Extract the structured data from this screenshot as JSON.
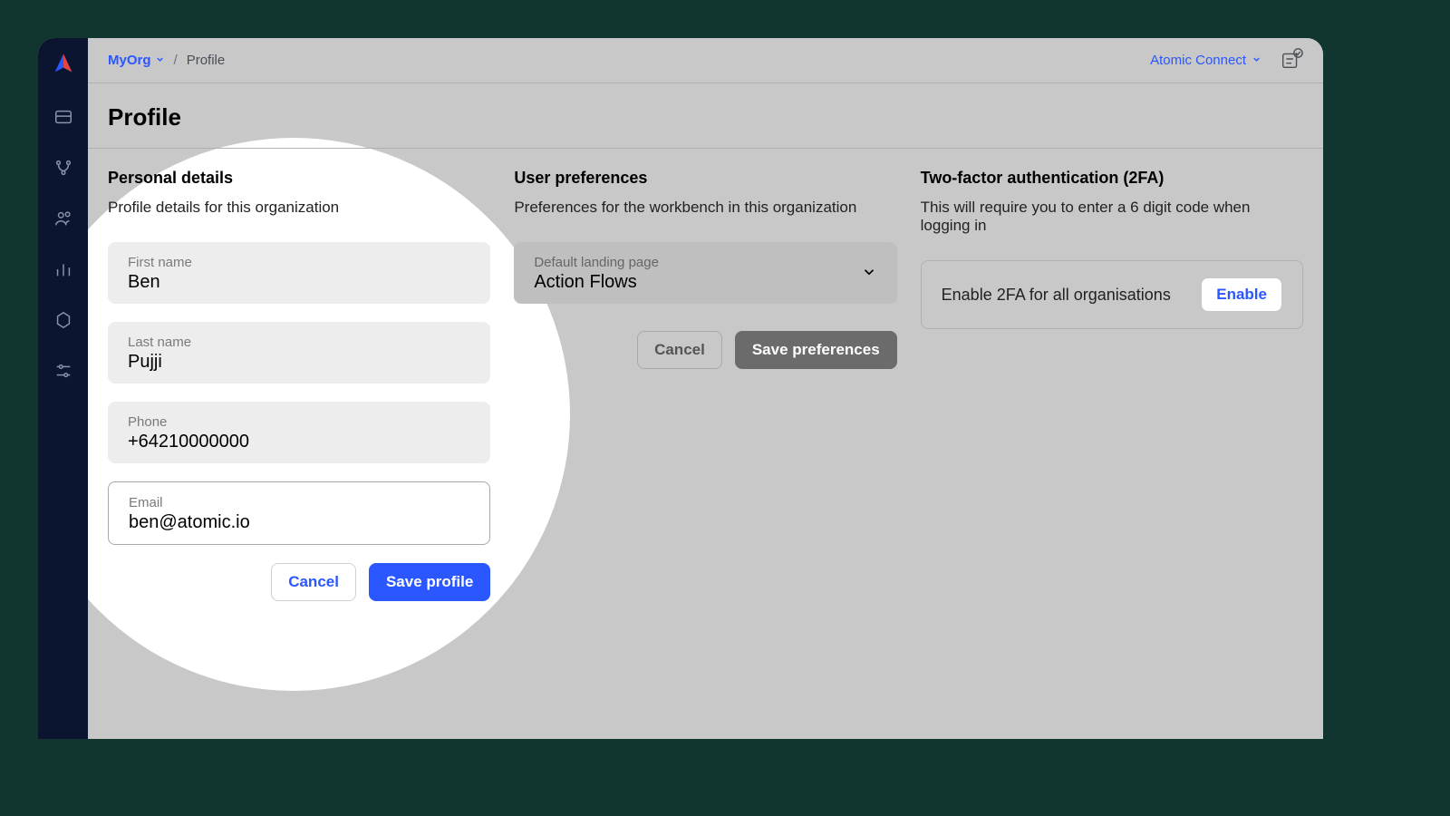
{
  "breadcrumb": {
    "org": "MyOrg",
    "page": "Profile"
  },
  "header": {
    "connect_label": "Atomic Connect"
  },
  "page": {
    "title": "Profile"
  },
  "personal": {
    "heading": "Personal details",
    "sub": "Profile details for this organization",
    "first_name_label": "First name",
    "first_name": "Ben",
    "last_name_label": "Last name",
    "last_name": "Pujji",
    "phone_label": "Phone",
    "phone": "+64210000000",
    "email_label": "Email",
    "email": "ben@atomic.io",
    "cancel": "Cancel",
    "save": "Save profile"
  },
  "prefs": {
    "heading": "User preferences",
    "sub": "Preferences for the workbench in this organization",
    "landing_label": "Default landing page",
    "landing_value": "Action Flows",
    "cancel": "Cancel",
    "save": "Save preferences"
  },
  "tfa": {
    "heading": "Two-factor authentication (2FA)",
    "sub": "This will require you to enter a 6 digit code when logging in",
    "label": "Enable 2FA for all organisations",
    "button": "Enable"
  }
}
